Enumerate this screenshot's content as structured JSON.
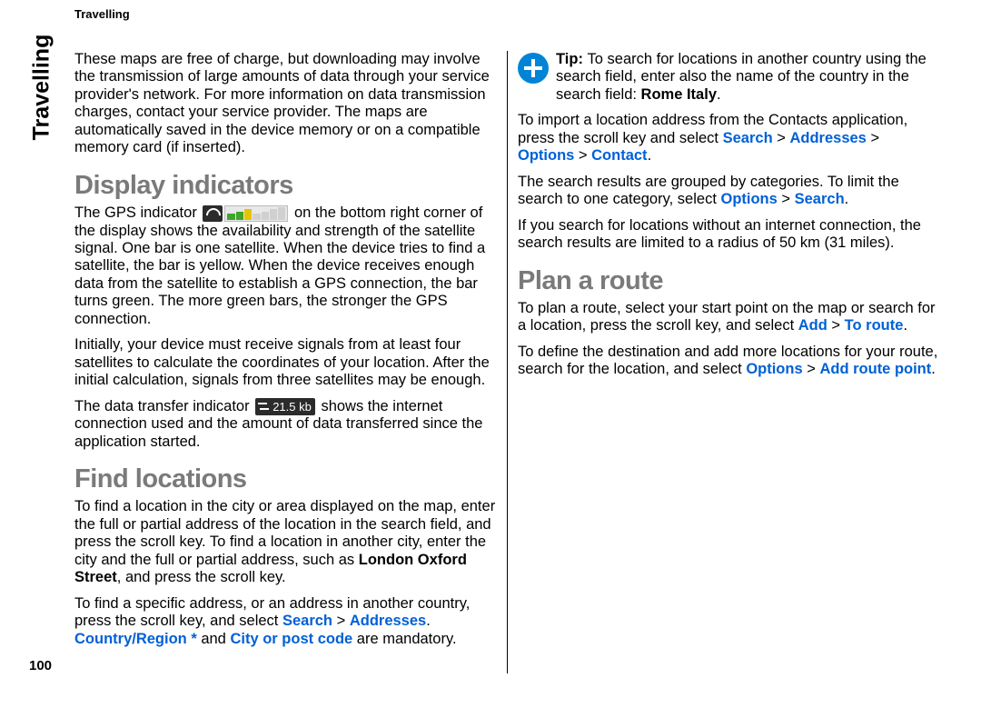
{
  "running_head": "Travelling",
  "side_tab": "Travelling",
  "page_number": "100",
  "intro_para": "These maps are free of charge, but downloading may involve the transmission of large amounts of data through your service provider's network. For more information on data transmission charges, contact your service provider. The maps are automatically saved in the device memory or on a compatible memory card (if inserted).",
  "h_display": "Display indicators",
  "gps_para_pre": "The GPS indicator ",
  "gps_para_post": " on the bottom right corner of the display shows the availability and strength of the satellite signal. One bar is one satellite. When the device tries to find a satellite, the bar is yellow. When the device receives enough data from the satellite to establish a GPS connection, the bar turns green. The more green bars, the stronger the GPS connection.",
  "sat_para": "Initially, your device must receive signals from at least four satellites to calculate the coordinates of your location. After the initial calculation, signals from three satellites may be enough.",
  "data_para_pre": "The data transfer indicator ",
  "data_indicator_text": "21.5 kb",
  "data_para_post": " shows the internet connection used and the amount of data transferred since the application started.",
  "h_find": "Find locations",
  "find_para": "To find a location in the city or area displayed on the map, enter the full or partial address of the location in the search field, and press the scroll key. To find a location in another city, enter the city and the full or partial address, such as ",
  "find_para_example": "London Oxford Street",
  "find_para_tail": ", and press the scroll key.",
  "addr_para_a": "To find a specific address, or an address in another country, press the scroll key, and select ",
  "addr_search": "Search",
  "gt": " > ",
  "addr_addresses": "Addresses",
  "addr_dot": ". ",
  "addr_country": "Country/Region *",
  "addr_and": " and ",
  "addr_city": "City or post code",
  "addr_tail": " are mandatory.",
  "tip_b": "Tip: ",
  "tip_text": "To search for locations in another country using the search field, enter also the name of the country in the search field: ",
  "tip_example": "Rome Italy",
  "tip_dot": ".",
  "import_a": "To import a location address from the Contacts application, press the scroll key and select ",
  "import_search": "Search",
  "import_addresses": "Addresses",
  "import_options": "Options",
  "import_contact": "Contact",
  "dot": ".",
  "group_a": "The search results are grouped by categories. To limit the search to one category, select ",
  "group_options": "Options",
  "group_search": "Search",
  "offline_para": "If you search for locations without an internet connection, the search results are limited to a radius of 50 km (31 miles).",
  "h_plan": "Plan a route",
  "plan_a": "To plan a route, select your start point on the map or search for a location, press the scroll key, and select ",
  "plan_add": "Add",
  "plan_toroute": "To route",
  "dest_a": "To define the destination and add more locations for your route, search for the location, and select ",
  "dest_options": "Options",
  "dest_addpoint": "Add route point"
}
